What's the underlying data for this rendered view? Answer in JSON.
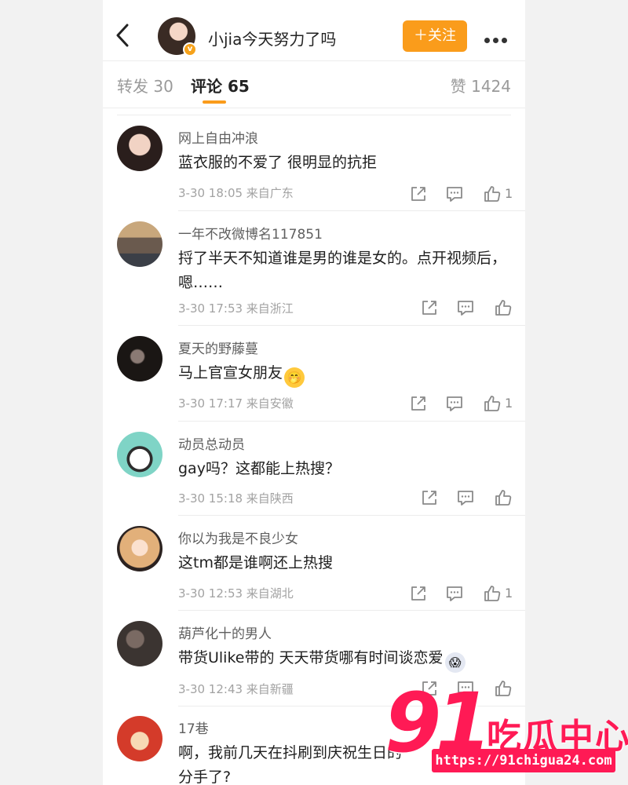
{
  "header": {
    "title": "小jia今天努力了吗",
    "follow_label": "＋关注",
    "verified_badge": "v"
  },
  "tabs": {
    "repost": "转发 30",
    "comments": "评论 65",
    "likes": "赞 1424"
  },
  "comments": [
    {
      "name": "网上自由冲浪",
      "text": "蓝衣服的不爱了 很明显的抗拒",
      "emoji": "",
      "meta": "3-30 18:05 来自广东",
      "likes": "1",
      "avatar_color": "#c79a86"
    },
    {
      "name": "一年不改微博名117851",
      "text": "捋了半天不知道谁是男的谁是女的。点开视频后，嗯……",
      "emoji": "",
      "meta": "3-30 17:53 来自浙江",
      "likes": "",
      "avatar_color": "#6b6f78"
    },
    {
      "name": "夏天的野藤蔓",
      "text": "马上官宣女朋友",
      "emoji": "🤭",
      "meta": "3-30 17:17 来自安徽",
      "likes": "1",
      "avatar_color": "#1f1a18"
    },
    {
      "name": "动员总动员",
      "text": "gay吗？这都能上热搜？",
      "emoji": "",
      "meta": "3-30 15:18 来自陕西",
      "likes": "",
      "avatar_color": "#7fd4c6"
    },
    {
      "name": "你以为我是不良少女",
      "text": "这tm都是谁啊还上热搜",
      "emoji": "",
      "meta": "3-30 12:53 来自湖北",
      "likes": "1",
      "avatar_color": "#e7b98d"
    },
    {
      "name": "葫芦化十的男人",
      "text": "带货Ulike带的 天天带货哪有时间谈恋爱",
      "emoji": "😱",
      "meta": "3-30 12:43 来自新疆",
      "likes": "",
      "avatar_color": "#3b3431"
    },
    {
      "name": "17巷",
      "text": "啊，我前几天在抖刷到庆祝生日的",
      "emoji": "",
      "extra": "分手了?",
      "meta": "",
      "likes": "",
      "avatar_color": "#d43b2a"
    }
  ],
  "watermark": {
    "number": "91",
    "brand": "吃瓜中心",
    "url": "https://91chigua24.com"
  },
  "colors": {
    "accent": "#fa9c1b",
    "watermark": "#ff1a55"
  }
}
